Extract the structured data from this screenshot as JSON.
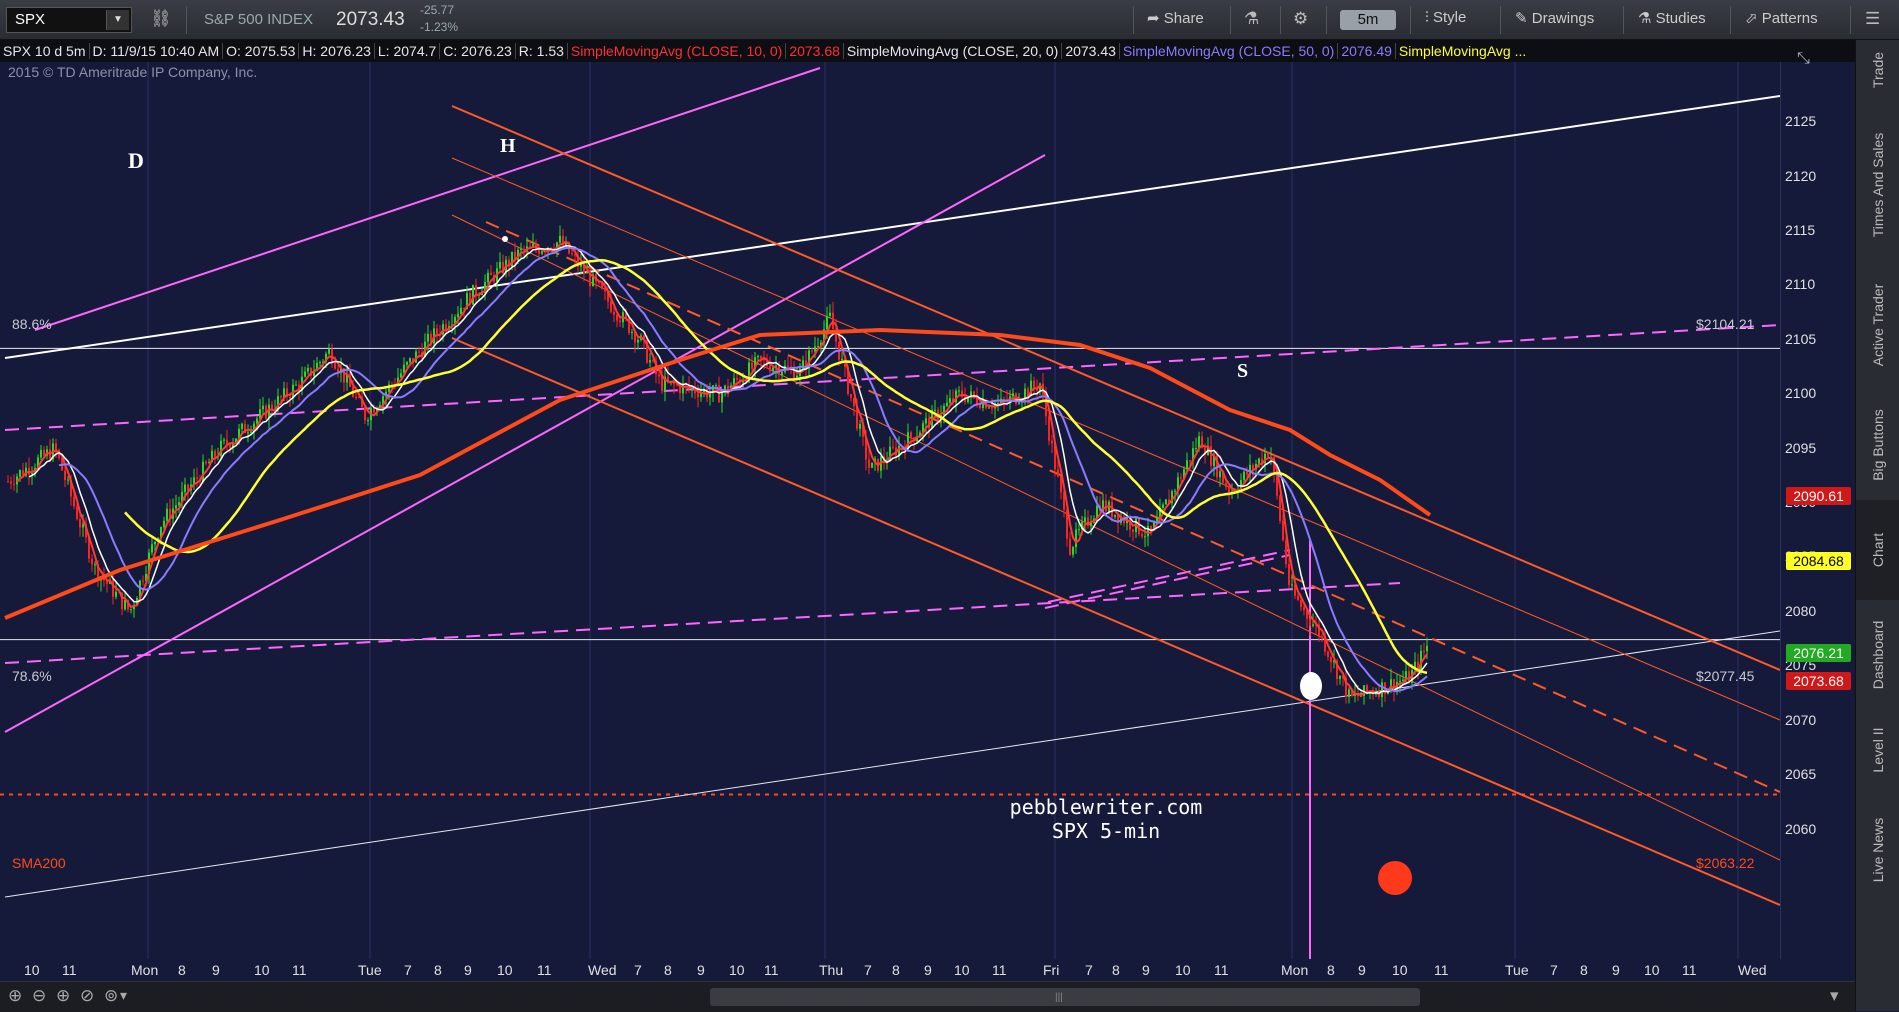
{
  "toolbar": {
    "symbol": "SPX",
    "index_name": "S&P 500 INDEX",
    "last_price": "2073.43",
    "change": "-25.77",
    "change_pct": "-1.23%",
    "timeframe": "5m",
    "share_label": "Share",
    "style_label": "Style",
    "drawings_label": "Drawings",
    "studies_label": "Studies",
    "patterns_label": "Patterns"
  },
  "infobar": {
    "symbol_period": "SPX 10 d 5m",
    "date": "D: 11/9/15 10:40 AM",
    "open": "O: 2075.53",
    "high": "H: 2076.23",
    "low": "L: 2074.7",
    "close": "C: 2076.23",
    "range": "R: 1.53",
    "sma10_label": "SimpleMovingAvg (CLOSE, 10, 0)",
    "sma10_value": "2073.68",
    "sma20_label": "SimpleMovingAvg (CLOSE, 20, 0)",
    "sma20_value": "2073.43",
    "sma50_label": "SimpleMovingAvg (CLOSE, 50, 0)",
    "sma50_value": "2076.49",
    "sma_more_label": "SimpleMovingAvg ..."
  },
  "chart": {
    "copyright": "2015 © TD Ameritrade IP Company, Inc.",
    "watermark_site": "pebblewriter.com",
    "watermark_desc": "SPX 5-min",
    "pattern_labels": {
      "d": "D",
      "h": "H",
      "s": "S"
    },
    "level_labels": {
      "fib_886": "88.6%",
      "fib_786": "78.6%",
      "sma200": "SMA200",
      "price_2104": "$2104.21",
      "price_2077": "$2077.45",
      "price_2063": "$2063.22"
    },
    "colors": {
      "background": "#161a3a",
      "sma10": "#ff3b30",
      "sma20": "#ffffff",
      "sma50": "#8a7cff",
      "sma100": "#ffff33",
      "sma200": "#ff4a1a",
      "channel": "#ff5a28",
      "magenta": "#ff66ff",
      "up_candle": "#22dd22",
      "down_candle": "#ff2222"
    }
  },
  "price_axis": {
    "ticks": [
      "2125",
      "2120",
      "2115",
      "2110",
      "2105",
      "2100",
      "2095",
      "2090",
      "2085",
      "2080",
      "2075",
      "2070",
      "2065",
      "2060"
    ],
    "tags": [
      {
        "value": "2090.61",
        "bg": "#d01818",
        "fg": "#ffffff"
      },
      {
        "value": "2084.68",
        "bg": "#ffff22",
        "fg": "#000000"
      },
      {
        "value": "2076.21",
        "bg": "#22aa22",
        "fg": "#ffffff"
      },
      {
        "value": "2073.68",
        "bg": "#d01818",
        "fg": "#ffffff"
      }
    ]
  },
  "time_axis": {
    "labels": [
      "10",
      "11",
      "Mon",
      "8",
      "9",
      "10",
      "11",
      "Tue",
      "7",
      "8",
      "9",
      "10",
      "11",
      "Wed",
      "7",
      "8",
      "9",
      "10",
      "11",
      "Thu",
      "7",
      "8",
      "9",
      "10",
      "11",
      "Fri",
      "7",
      "8",
      "9",
      "10",
      "11",
      "Mon",
      "8",
      "9",
      "10",
      "11",
      "Tue",
      "7",
      "8",
      "9",
      "10",
      "11",
      "Wed"
    ]
  },
  "side_tabs": [
    "Trade",
    "Times And Sales",
    "Active Trader",
    "Big Buttons",
    "Chart",
    "Dashboard",
    "Level II",
    "Live News"
  ]
}
